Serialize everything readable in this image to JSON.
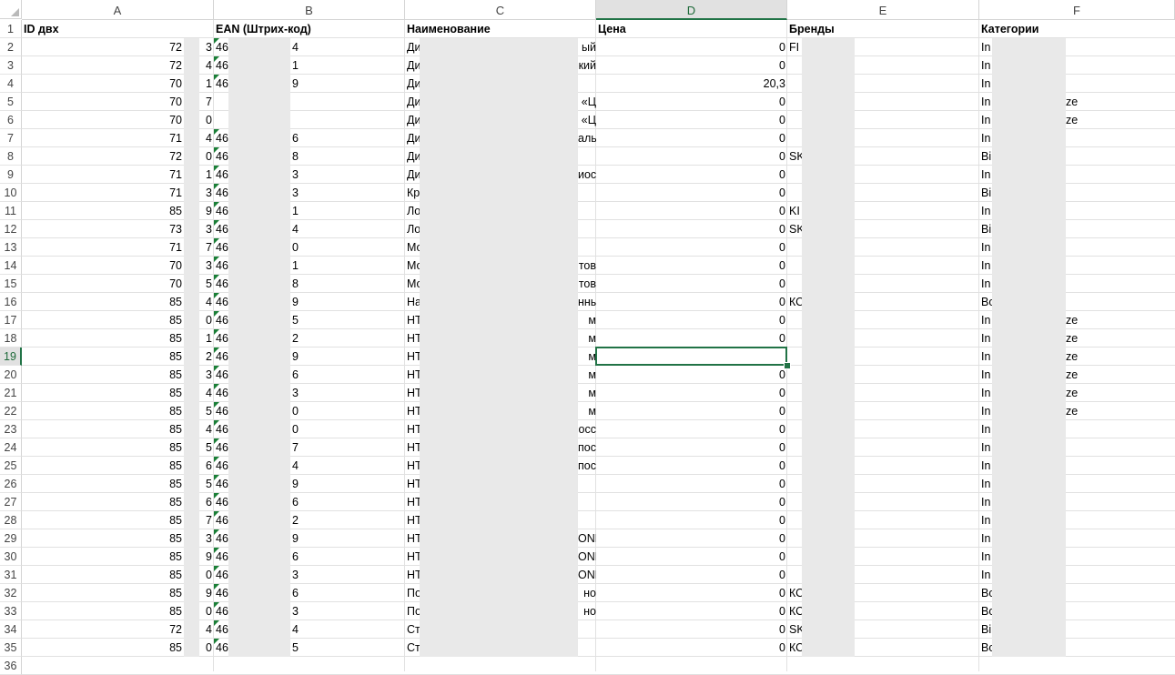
{
  "columns": [
    "A",
    "B",
    "C",
    "D",
    "E",
    "F"
  ],
  "active_column": "D",
  "active_row": 19,
  "header_row": {
    "id": "ID двх",
    "ean": "EAN (Штрих-код)",
    "name": "Наименование",
    "price": "Цена",
    "brand": "Бренды",
    "category": "Категории"
  },
  "rows": [
    {
      "n": "2",
      "id_a": "72",
      "id_b": "3",
      "ean_a": "46",
      "ean_b": "4",
      "name_a": "Ди",
      "name_b": "ый",
      "price": "0",
      "brand": "FI",
      "cat_a": "In",
      "cat_b": ""
    },
    {
      "n": "3",
      "id_a": "72",
      "id_b": "4",
      "ean_a": "46",
      "ean_b": "1",
      "name_a": "Ди",
      "name_b": "кий",
      "price": "0",
      "brand": "",
      "cat_a": "In",
      "cat_b": ""
    },
    {
      "n": "4",
      "id_a": "70",
      "id_b": "1",
      "ean_a": "46",
      "ean_b": "9",
      "name_a": "Ди",
      "name_b": "",
      "price": "20,3",
      "brand": "",
      "cat_a": "In",
      "cat_b": ""
    },
    {
      "n": "5",
      "id_a": "70",
      "id_b": "7",
      "ean_a": "",
      "ean_b": "",
      "name_a": "Ди",
      "name_b": "«Ц",
      "price": "0",
      "brand": "",
      "cat_a": "In",
      "cat_b": "ze"
    },
    {
      "n": "6",
      "id_a": "70",
      "id_b": "0",
      "ean_a": "",
      "ean_b": "",
      "name_a": "Ди",
      "name_b": "«Ц",
      "price": "0",
      "brand": "",
      "cat_a": "In",
      "cat_b": "ze"
    },
    {
      "n": "7",
      "id_a": "71",
      "id_b": "4",
      "ean_a": "46",
      "ean_b": "6",
      "name_a": "Ди",
      "name_b": "аль",
      "price": "0",
      "brand": "",
      "cat_a": "In",
      "cat_b": ""
    },
    {
      "n": "8",
      "id_a": "72",
      "id_b": "0",
      "ean_a": "46",
      "ean_b": "8",
      "name_a": "Ди",
      "name_b": "",
      "price": "0",
      "brand": "SK",
      "cat_a": "Bi",
      "cat_b": ""
    },
    {
      "n": "9",
      "id_a": "71",
      "id_b": "1",
      "ean_a": "46",
      "ean_b": "3",
      "name_a": "Ди",
      "name_b": "иос",
      "price": "0",
      "brand": "",
      "cat_a": "In",
      "cat_b": ""
    },
    {
      "n": "10",
      "id_a": "71",
      "id_b": "3",
      "ean_a": "46",
      "ean_b": "3",
      "name_a": "Кр",
      "name_b": "",
      "price": "0",
      "brand": "",
      "cat_a": "Bi",
      "cat_b": ""
    },
    {
      "n": "11",
      "id_a": "85",
      "id_b": "9",
      "ean_a": "46",
      "ean_b": "1",
      "name_a": "Ло",
      "name_b": "",
      "price": "0",
      "brand": "KI",
      "cat_a": "In",
      "cat_b": ""
    },
    {
      "n": "12",
      "id_a": "73",
      "id_b": "3",
      "ean_a": "46",
      "ean_b": "4",
      "name_a": "Ло",
      "name_b": "",
      "price": "0",
      "brand": "SK",
      "cat_a": "Bi",
      "cat_b": ""
    },
    {
      "n": "13",
      "id_a": "71",
      "id_b": "7",
      "ean_a": "46",
      "ean_b": "0",
      "name_a": "Мо",
      "name_b": "",
      "price": "0",
      "brand": "",
      "cat_a": "In",
      "cat_b": ""
    },
    {
      "n": "14",
      "id_a": "70",
      "id_b": "3",
      "ean_a": "46",
      "ean_b": "1",
      "name_a": "Мо",
      "name_b": "тов",
      "price": "0",
      "brand": "",
      "cat_a": "In",
      "cat_b": ""
    },
    {
      "n": "15",
      "id_a": "70",
      "id_b": "5",
      "ean_a": "46",
      "ean_b": "8",
      "name_a": "Мо",
      "name_b": "тов",
      "price": "0",
      "brand": "",
      "cat_a": "In",
      "cat_b": ""
    },
    {
      "n": "16",
      "id_a": "85",
      "id_b": "4",
      "ean_a": "46",
      "ean_b": "9",
      "name_a": "На",
      "name_b": "нны",
      "price": "0",
      "brand": "КС",
      "cat_a": "Bo",
      "cat_b": ""
    },
    {
      "n": "17",
      "id_a": "85",
      "id_b": "0",
      "ean_a": "46",
      "ean_b": "5",
      "name_a": "НТ",
      "name_b": "м",
      "price": "0",
      "brand": "",
      "cat_a": "In",
      "cat_b": "ze"
    },
    {
      "n": "18",
      "id_a": "85",
      "id_b": "1",
      "ean_a": "46",
      "ean_b": "2",
      "name_a": "НТ",
      "name_b": "м",
      "price": "0",
      "brand": "",
      "cat_a": "In",
      "cat_b": "ze"
    },
    {
      "n": "19",
      "id_a": "85",
      "id_b": "2",
      "ean_a": "46",
      "ean_b": "9",
      "name_a": "НТ",
      "name_b": "м",
      "price": "",
      "brand": "",
      "cat_a": "In",
      "cat_b": "ze"
    },
    {
      "n": "20",
      "id_a": "85",
      "id_b": "3",
      "ean_a": "46",
      "ean_b": "6",
      "name_a": "НТ",
      "name_b": "м",
      "price": "0",
      "brand": "",
      "cat_a": "In",
      "cat_b": "ze"
    },
    {
      "n": "21",
      "id_a": "85",
      "id_b": "4",
      "ean_a": "46",
      "ean_b": "3",
      "name_a": "НТ",
      "name_b": "м",
      "price": "0",
      "brand": "",
      "cat_a": "In",
      "cat_b": "ze"
    },
    {
      "n": "22",
      "id_a": "85",
      "id_b": "5",
      "ean_a": "46",
      "ean_b": "0",
      "name_a": "НТ",
      "name_b": "м",
      "price": "0",
      "brand": "",
      "cat_a": "In",
      "cat_b": "ze"
    },
    {
      "n": "23",
      "id_a": "85",
      "id_b": "4",
      "ean_a": "46",
      "ean_b": "0",
      "name_a": "НТ",
      "name_b": "осс",
      "price": "0",
      "brand": "",
      "cat_a": "In",
      "cat_b": ""
    },
    {
      "n": "24",
      "id_a": "85",
      "id_b": "5",
      "ean_a": "46",
      "ean_b": "7",
      "name_a": "НТ",
      "name_b": "пос",
      "price": "0",
      "brand": "",
      "cat_a": "In",
      "cat_b": ""
    },
    {
      "n": "25",
      "id_a": "85",
      "id_b": "6",
      "ean_a": "46",
      "ean_b": "4",
      "name_a": "НТ",
      "name_b": "пос",
      "price": "0",
      "brand": "",
      "cat_a": "In",
      "cat_b": ""
    },
    {
      "n": "26",
      "id_a": "85",
      "id_b": "5",
      "ean_a": "46",
      "ean_b": "9",
      "name_a": "НТ",
      "name_b": "",
      "price": "0",
      "brand": "",
      "cat_a": "In",
      "cat_b": ""
    },
    {
      "n": "27",
      "id_a": "85",
      "id_b": "6",
      "ean_a": "46",
      "ean_b": "6",
      "name_a": "НТ",
      "name_b": "",
      "price": "0",
      "brand": "",
      "cat_a": "In",
      "cat_b": ""
    },
    {
      "n": "28",
      "id_a": "85",
      "id_b": "7",
      "ean_a": "46",
      "ean_b": "2",
      "name_a": "НТ",
      "name_b": "",
      "price": "0",
      "brand": "",
      "cat_a": "In",
      "cat_b": ""
    },
    {
      "n": "29",
      "id_a": "85",
      "id_b": "3",
      "ean_a": "46",
      "ean_b": "9",
      "name_a": "НТ",
      "name_b": "ONF",
      "price": "0",
      "brand": "",
      "cat_a": "In",
      "cat_b": ""
    },
    {
      "n": "30",
      "id_a": "85",
      "id_b": "9",
      "ean_a": "46",
      "ean_b": "6",
      "name_a": "НТ",
      "name_b": "ONF",
      "price": "0",
      "brand": "",
      "cat_a": "In",
      "cat_b": ""
    },
    {
      "n": "31",
      "id_a": "85",
      "id_b": "0",
      "ean_a": "46",
      "ean_b": "3",
      "name_a": "НТ",
      "name_b": "ONF",
      "price": "0",
      "brand": "",
      "cat_a": "In",
      "cat_b": ""
    },
    {
      "n": "32",
      "id_a": "85",
      "id_b": "9",
      "ean_a": "46",
      "ean_b": "6",
      "name_a": "По",
      "name_b": "но",
      "price": "0",
      "brand": "КС",
      "cat_a": "Bo",
      "cat_b": ""
    },
    {
      "n": "33",
      "id_a": "85",
      "id_b": "0",
      "ean_a": "46",
      "ean_b": "3",
      "name_a": "По",
      "name_b": "но",
      "price": "0",
      "brand": "КС",
      "cat_a": "Bo",
      "cat_b": ""
    },
    {
      "n": "34",
      "id_a": "72",
      "id_b": "4",
      "ean_a": "46",
      "ean_b": "4",
      "name_a": "Ст",
      "name_b": "",
      "price": "0",
      "brand": "SK",
      "cat_a": "Bi",
      "cat_b": ""
    },
    {
      "n": "35",
      "id_a": "85",
      "id_b": "0",
      "ean_a": "46",
      "ean_b": "5",
      "name_a": "Ст",
      "name_b": "",
      "price": "0",
      "brand": "КС",
      "cat_a": "Bo",
      "cat_b": ""
    }
  ],
  "last_row_label": "36",
  "colors": {
    "active_header": "#217346",
    "flag": "#1a7f37",
    "redaction": "#e9e9e9"
  }
}
